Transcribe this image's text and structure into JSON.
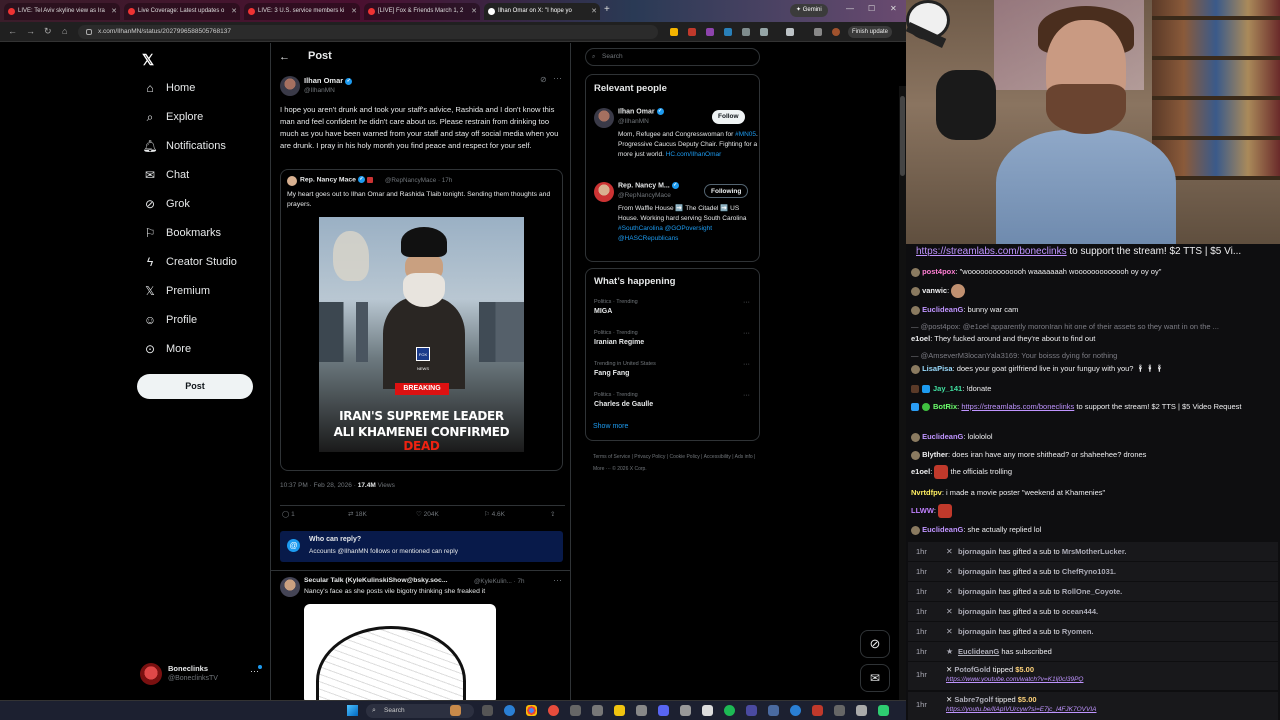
{
  "browser": {
    "tabs": [
      {
        "title": "LIVE: Tel Aviv skyline view as Ira"
      },
      {
        "title": "Live Coverage: Latest updates o"
      },
      {
        "title": "LIVE: 3 U.S. service members ki"
      },
      {
        "title": "[LIVE] Fox & Friends March 1, 2"
      },
      {
        "title": "Ilhan Omar on X: \"I hope yo"
      }
    ],
    "gemini_label": "Gemini",
    "url": "x.com/IlhanMN/status/2027996588505768137",
    "finish_update_label": "Finish update"
  },
  "x": {
    "nav": [
      {
        "label": "Home",
        "icon": "home-icon"
      },
      {
        "label": "Explore",
        "icon": "search-icon"
      },
      {
        "label": "Notifications",
        "icon": "bell-icon"
      },
      {
        "label": "Chat",
        "icon": "chat-icon"
      },
      {
        "label": "Grok",
        "icon": "grok-icon"
      },
      {
        "label": "Bookmarks",
        "icon": "bookmark-icon"
      },
      {
        "label": "Creator Studio",
        "icon": "lightning-icon"
      },
      {
        "label": "Premium",
        "icon": "x-logo-icon"
      },
      {
        "label": "Profile",
        "icon": "person-icon"
      },
      {
        "label": "More",
        "icon": "more-circle-icon"
      }
    ],
    "post_button": "Post",
    "account": {
      "name": "Boneclinks",
      "handle": "@BoneclinksTV"
    },
    "header": "Post",
    "post": {
      "author": "Ilhan Omar",
      "handle": "@IlhanMN",
      "text": "I hope you aren't drunk and took your staff's advice, Rashida and I don't know this man and feel confident he didn't care about us. Please restrain from drinking too much as you have been warned from your staff and stay off social media when you are drunk. I pray in his holy month you find peace and respect for your self.",
      "quote": {
        "author": "Rep. Nancy Mace",
        "handle": "@RepNancyMace · 17h",
        "text": "My heart goes out to Ilhan Omar and Rashida Tlaib tonight. Sending them thoughts and prayers.",
        "image": {
          "badge": "BREAKING",
          "headline_line1": "IRAN'S SUPREME LEADER",
          "headline_line2_pre": "ALI KHAMENEI CONFIRMED",
          "headline_line2_red": "DEAD",
          "network": "FOX NEWS"
        }
      },
      "time": "10:37 PM · Feb 28, 2026 ·",
      "views_count": "17.4M",
      "views_label": "Views",
      "stats": {
        "replies": "1",
        "reposts": "18K",
        "likes": "204K",
        "bookmarks": "4.6K"
      },
      "who_can_reply_title": "Who can reply?",
      "who_can_reply_sub": "Accounts @IlhanMN follows or mentioned can reply"
    },
    "reply": {
      "author": "Secular Talk (KyleKulinskiShow@bsky.soc...",
      "handle": "@KyleKulin... · 7h",
      "text": "Nancy's face as she posts vile bigotry thinking she freaked it"
    },
    "search_placeholder": "Search",
    "relevant_title": "Relevant people",
    "relevant": [
      {
        "name": "Ilhan Omar",
        "handle": "@IlhanMN",
        "button": "Follow",
        "bio_pre": "Mom, Refugee and Congresswoman for",
        "bio_link1": "#MN05",
        "bio_mid": ". Progressive Caucus Deputy Chair. Fighting for a more just world.",
        "bio_link2": "HC.com/IlhanOmar"
      },
      {
        "name": "Rep. Nancy M...",
        "handle": "@RepNancyMace",
        "button": "Following",
        "bio_pre": "From Waffle House ➡️ The Citadel ➡️ US House. Working hard serving South Carolina",
        "bio_link1": "#SouthCarolina",
        "bio_mid": "",
        "bio_link2": "@GOPoversight @HASCRepublicans"
      }
    ],
    "happening_title": "What’s happening",
    "trends": [
      {
        "category": "Politics · Trending",
        "name": "MIGA"
      },
      {
        "category": "Politics · Trending",
        "name": "Iranian Regime"
      },
      {
        "category": "Trending in United States",
        "name": "Fang Fang"
      },
      {
        "category": "Politics · Trending",
        "name": "Charles de Gaulle"
      }
    ],
    "show_more": "Show more",
    "footer": "Terms of Service  |  Privacy Policy  |  Cookie Policy  |  Accessibility  |  Ads info  |  More ···  © 2026 X Corp."
  },
  "stream": {
    "banner_link": "https://streamlabs.com/boneclinks",
    "banner_text": " to support the stream! $2 TTS | $5 Vi...",
    "chat": [
      {
        "user": "post4pox",
        "color": "#ff7fd4",
        "text": "\"woooooooooooooh waaaaaaah wooooooooooooh oy oy oy\""
      },
      {
        "user": "vanwic",
        "color": "#ffffff",
        "text": ""
      },
      {
        "user": "EuclideanG",
        "color": "#bf94ff",
        "text": "bunny war cam"
      },
      {
        "user": "",
        "color": "#7d7d85",
        "text": "— @post4pox: @e1oel apparently moronIran hit one of their assets so they want in on the ..."
      },
      {
        "user": "e1oel",
        "color": "#ffffff",
        "text": "They fucked around and they're about to find out"
      },
      {
        "user": "",
        "color": "#7d7d85",
        "text": "— @AmseverM3locanYala3169: Your boisss dying for nothing"
      },
      {
        "user": "LisaPisa",
        "color": "#9adcff",
        "text": "does your goat girlfriend live in your funguy with you?"
      },
      {
        "user": "Jay_141",
        "color": "#40e0a0",
        "text": "!donate"
      },
      {
        "user": "BotRix",
        "color": "#6cff6c",
        "text": "to support the stream! $2 TTS | $5 Video Request",
        "link": "https://streamlabs.com/boneclinks"
      },
      {
        "user": "EuclideanG",
        "color": "#bf94ff",
        "text": "lolololol"
      },
      {
        "user": "Blyther",
        "color": "#ffffff",
        "text": "does iran have any more shithead? or shaheehee? drones"
      },
      {
        "user": "e1oel",
        "color": "#ffffff",
        "text": "the officials trolling"
      },
      {
        "user": "Nvrtdfpv",
        "color": "#ffef60",
        "text": "i made a movie poster \"weekend at Khamenies\""
      },
      {
        "user": "LLWW",
        "color": "#c080ff",
        "text": ""
      },
      {
        "user": "EuclideanG",
        "color": "#bf94ff",
        "text": "she actually replied lol"
      }
    ],
    "events": [
      {
        "time": "1hr",
        "user": "bjornagain",
        "action": "has gifted a sub to",
        "target": "MrsMotherLucker."
      },
      {
        "time": "1hr",
        "user": "bjornagain",
        "action": "has gifted a sub to",
        "target": "ChefRyno1031."
      },
      {
        "time": "1hr",
        "user": "bjornagain",
        "action": "has gifted a sub to",
        "target": "RollOne_Coyote."
      },
      {
        "time": "1hr",
        "user": "bjornagain",
        "action": "has gifted a sub to",
        "target": "ocean444."
      },
      {
        "time": "1hr",
        "user": "bjornagain",
        "action": "has gifted a sub to",
        "target": "Ryomen."
      },
      {
        "time": "1hr",
        "user": "EuclideanG",
        "action": "has subscribed",
        "target": ""
      }
    ],
    "tips": [
      {
        "time": "1hr",
        "user": "PotofGold",
        "action": "tipped",
        "amount": "$5.00",
        "link": "https://www.youtube.com/watch?v=K1lj0cl39PQ"
      },
      {
        "time": "1hr",
        "user": "Sabre7golf",
        "action": "tipped",
        "amount": "$5.00",
        "link": "https://youtu.be/lIApIVUrcyw?si=E7jc_I4FJK7OVVIA"
      }
    ]
  },
  "taskbar": {
    "search_placeholder": "Search"
  }
}
